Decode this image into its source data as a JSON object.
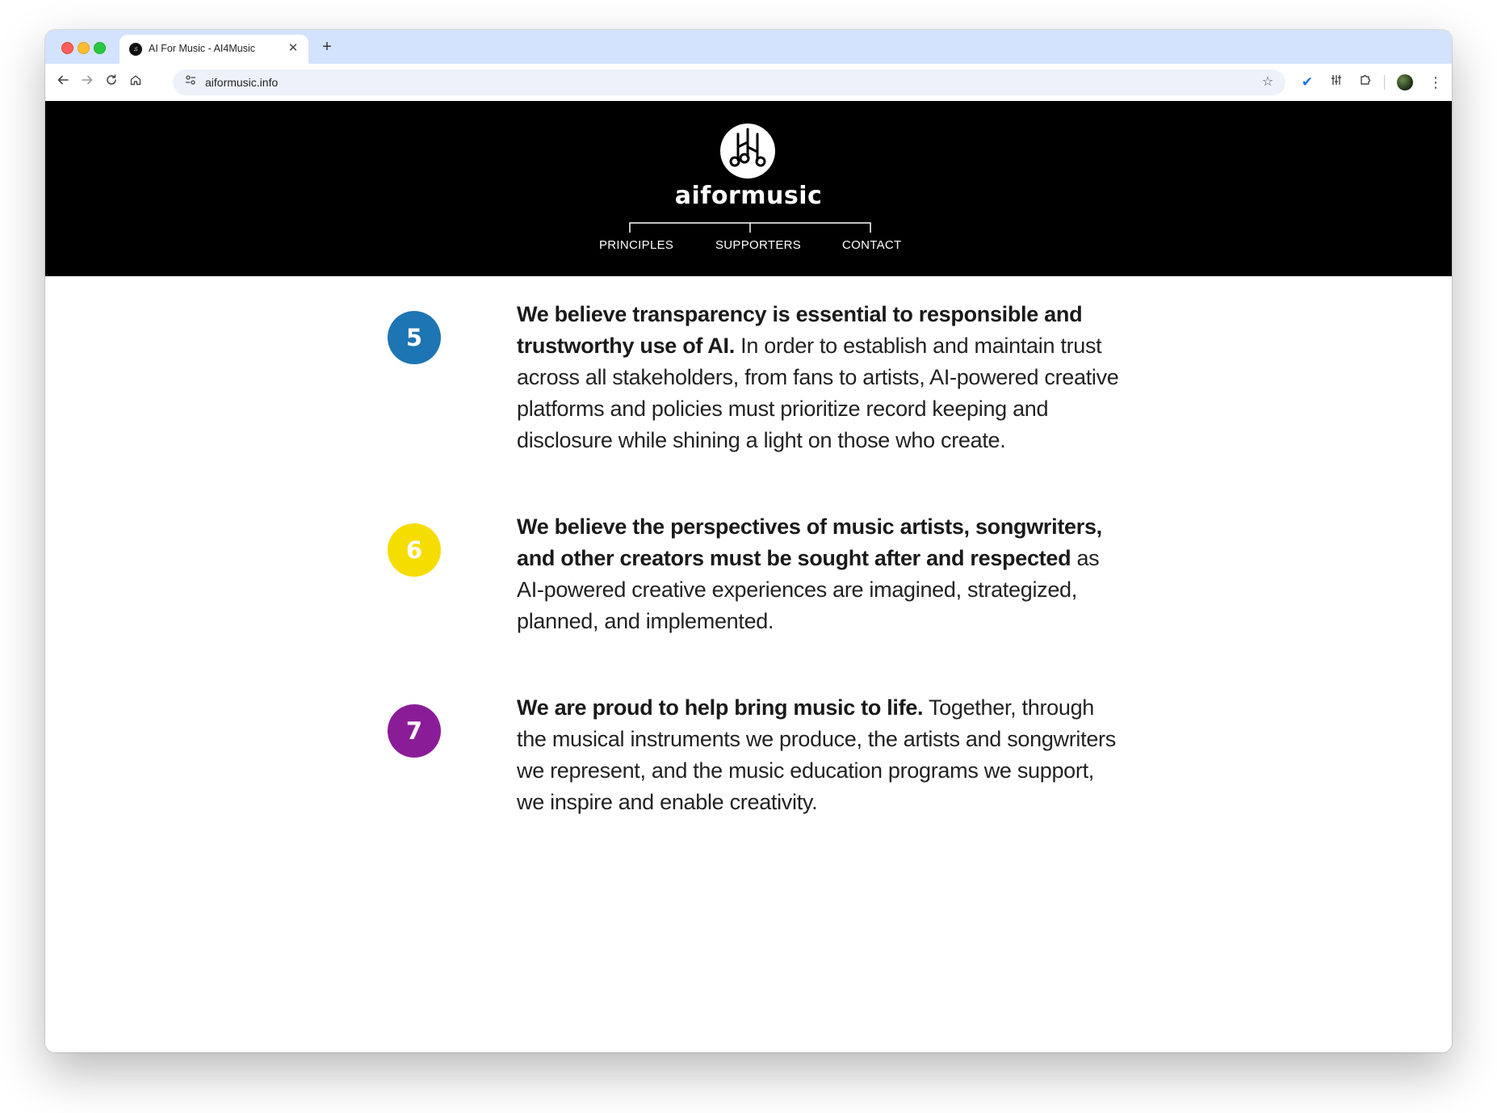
{
  "browser": {
    "tab_title": "AI For Music - AI4Music",
    "tab_close": "✕",
    "new_tab": "+",
    "url": "aiformusic.info",
    "icons": [
      "back-icon",
      "forward-icon",
      "reload-icon",
      "home-icon",
      "site-settings-icon",
      "bookmark-star-icon",
      "checkmark-extension-icon",
      "extension-icon",
      "puzzle-extensions-icon",
      "tab-search-icon",
      "profile-avatar",
      "more-menu-icon"
    ]
  },
  "site": {
    "logo_text": "aiformusic",
    "nav": {
      "principles": "PRINCIPLES",
      "supporters": "SUPPORTERS",
      "contact": "CONTACT"
    }
  },
  "principles": [
    {
      "number": "5",
      "color": "#1d75b3",
      "bold": "We believe transparency is essential to responsible and trustworthy use of AI.",
      "text": " In order to establish and maintain trust across all stakeholders, from fans to artists, AI-powered creative platforms and policies must prioritize record keeping and disclosure while shining a light on those who create."
    },
    {
      "number": "6",
      "color": "#f5dd00",
      "bold": "We believe the perspectives of music artists, songwriters, and other creators must be sought after and respected",
      "text": " as AI-powered creative experiences are imagined, strategized, planned, and implemented."
    },
    {
      "number": "7",
      "color": "#8b1c98",
      "bold": "We are proud to help bring music to life.",
      "text": " Together, through the musical instruments we produce, the artists and songwriters we represent, and the music education programs we support, we inspire and enable creativity."
    }
  ]
}
